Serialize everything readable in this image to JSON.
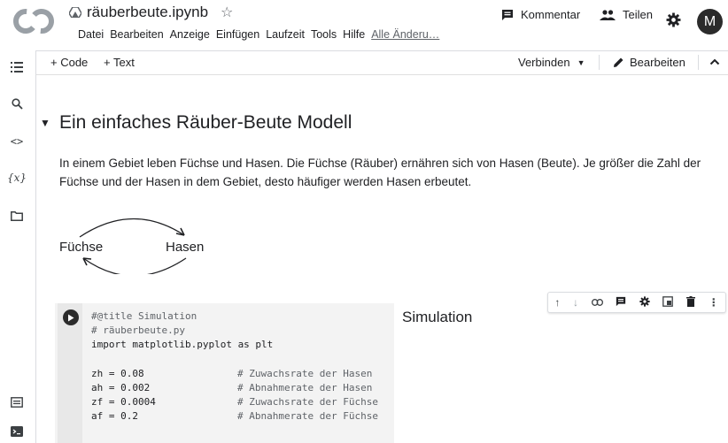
{
  "header": {
    "notebook_title": "räuberbeute.ipynb",
    "menu": [
      "Datei",
      "Bearbeiten",
      "Anzeige",
      "Einfügen",
      "Laufzeit",
      "Tools",
      "Hilfe"
    ],
    "changes_link": "Alle Änderu…",
    "comment_label": "Kommentar",
    "share_label": "Teilen",
    "avatar_letter": "M"
  },
  "toolbar": {
    "add_code": "+ Code",
    "add_text": "+ Text",
    "connect": "Verbinden",
    "edit": "Bearbeiten"
  },
  "content": {
    "heading": "Ein einfaches Räuber-Beute Modell",
    "paragraph": "In einem Gebiet leben Füchse und Hasen. Die Füchse (Räuber) ernähren sich von Hasen (Beute). Je größer die Zahl der Füchse und der Hasen in dem Gebiet, desto häufiger werden Hasen erbeutet.",
    "diagram_left": "Füchse",
    "diagram_right": "Hasen"
  },
  "cell": {
    "title_output": "Simulation",
    "code_lines": [
      {
        "code": "#@title Simulation",
        "comment": ""
      },
      {
        "code": "# räuberbeute.py",
        "comment": ""
      },
      {
        "code": "import matplotlib.pyplot as plt",
        "comment": ""
      },
      {
        "code": "",
        "comment": ""
      },
      {
        "code": "zh = 0.08",
        "comment": "# Zuwachsrate der Hasen"
      },
      {
        "code": "ah = 0.002",
        "comment": "# Abnahmerate der Hasen"
      },
      {
        "code": "zf = 0.0004",
        "comment": "# Zuwachsrate der Füchse"
      },
      {
        "code": "af = 0.2",
        "comment": "# Abnahmerate der Füchse"
      }
    ]
  },
  "colors": {
    "accent_dark": "#2b2b2b",
    "logo_orange": "#f9ab00",
    "divider": "#dadce0"
  }
}
